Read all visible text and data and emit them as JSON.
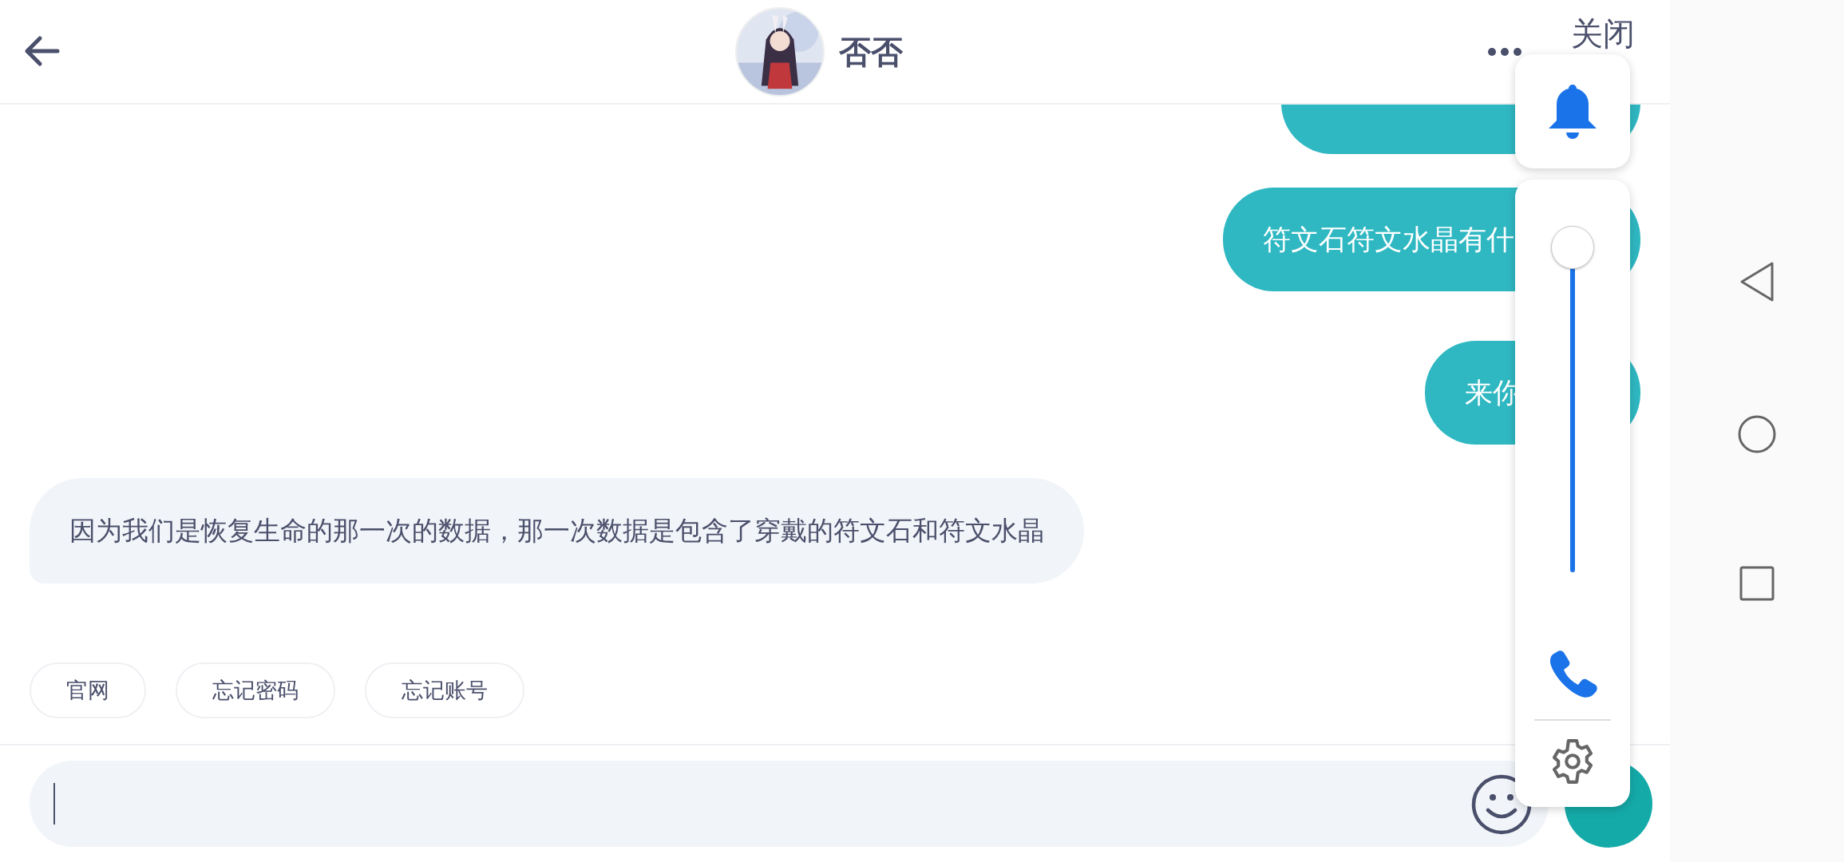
{
  "header": {
    "title": "否否",
    "close": "关闭"
  },
  "messages": [
    {
      "kind": "outgoing"
    },
    {
      "kind": "outgoing",
      "text": "符文石符文水晶有什"
    },
    {
      "kind": "outgoing",
      "text": "来你"
    },
    {
      "kind": "incoming",
      "text": "因为我们是恢复生命的那一次的数据，那一次数据是包含了穿戴的符文石和符文水晶"
    }
  ],
  "quick_replies": [
    "官网",
    "忘记密码",
    "忘记账号"
  ],
  "volume_panel": {
    "level": 0.97
  }
}
